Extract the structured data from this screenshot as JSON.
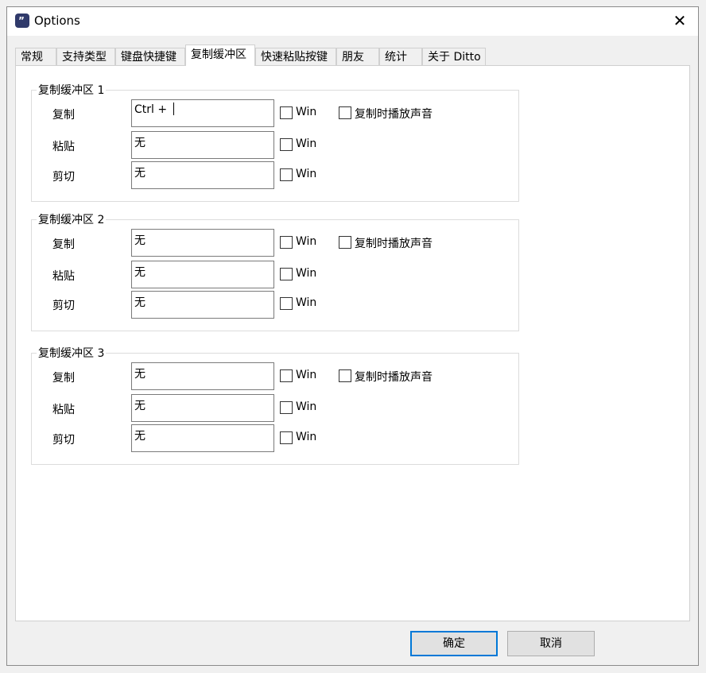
{
  "window": {
    "title": "Options",
    "app_icon_glyph": "”"
  },
  "tabs": [
    {
      "label": "常规"
    },
    {
      "label": "支持类型"
    },
    {
      "label": "键盘快捷键"
    },
    {
      "label": "复制缓冲区",
      "active": true
    },
    {
      "label": "快速粘贴按键"
    },
    {
      "label": "朋友"
    },
    {
      "label": "统计"
    },
    {
      "label": "关于 Ditto"
    }
  ],
  "groups": [
    {
      "title": "复制缓冲区 1",
      "rows": [
        {
          "label": "复制",
          "value": "Ctrl + ",
          "win_label": "Win",
          "win_checked": false
        },
        {
          "label": "粘贴",
          "value": "无",
          "win_label": "Win",
          "win_checked": false
        },
        {
          "label": "剪切",
          "value": "无",
          "win_label": "Win",
          "win_checked": false
        }
      ],
      "sound_label": "复制时播放声音",
      "sound_checked": false
    },
    {
      "title": "复制缓冲区 2",
      "rows": [
        {
          "label": "复制",
          "value": "无",
          "win_label": "Win",
          "win_checked": false
        },
        {
          "label": "粘贴",
          "value": "无",
          "win_label": "Win",
          "win_checked": false
        },
        {
          "label": "剪切",
          "value": "无",
          "win_label": "Win",
          "win_checked": false
        }
      ],
      "sound_label": "复制时播放声音",
      "sound_checked": false
    },
    {
      "title": "复制缓冲区 3",
      "rows": [
        {
          "label": "复制",
          "value": "无",
          "win_label": "Win",
          "win_checked": false
        },
        {
          "label": "粘贴",
          "value": "无",
          "win_label": "Win",
          "win_checked": false
        },
        {
          "label": "剪切",
          "value": "无",
          "win_label": "Win",
          "win_checked": false
        }
      ],
      "sound_label": "复制时播放声音",
      "sound_checked": false
    }
  ],
  "buttons": {
    "ok": "确定",
    "cancel": "取消"
  },
  "colors": {
    "accent": "#0078d7",
    "app_icon": "#303a6b"
  }
}
